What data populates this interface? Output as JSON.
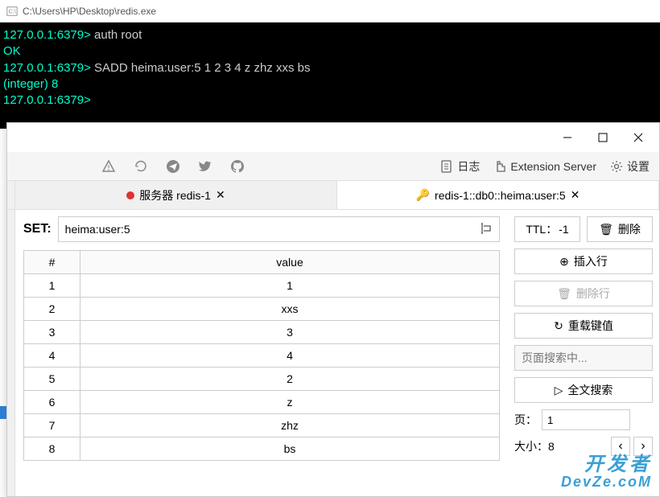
{
  "terminal": {
    "title": "C:\\Users\\HP\\Desktop\\redis.exe",
    "lines": [
      {
        "prompt": "127.0.0.1:6379>",
        "cmd": " auth root"
      },
      {
        "out": "OK"
      },
      {
        "prompt": "127.0.0.1:6379>",
        "cmd": " SADD heima:user:5  1 2 3 4 z zhz xxs bs"
      },
      {
        "out": "(integer) 8"
      },
      {
        "prompt": "127.0.0.1:6379>",
        "cmd": ""
      }
    ]
  },
  "toolbar": {
    "log_label": "日志",
    "ext_label": "Extension Server",
    "settings_label": "设置"
  },
  "tabs": {
    "server": {
      "label": "服务器 redis-1"
    },
    "key": {
      "label": "redis-1::db0::heima:user:5"
    }
  },
  "key_panel": {
    "type_label": "SET:",
    "key_name": "heima:user:5",
    "ttl_label": "TTL：",
    "ttl_value": "-1",
    "delete_label": "删除",
    "columns": {
      "index": "#",
      "value": "value"
    },
    "rows": [
      {
        "i": "1",
        "v": "1"
      },
      {
        "i": "2",
        "v": "xxs"
      },
      {
        "i": "3",
        "v": "3"
      },
      {
        "i": "4",
        "v": "4"
      },
      {
        "i": "5",
        "v": "2"
      },
      {
        "i": "6",
        "v": "z"
      },
      {
        "i": "7",
        "v": "zhz"
      },
      {
        "i": "8",
        "v": "bs"
      }
    ]
  },
  "side": {
    "insert_label": "插入行",
    "delete_row_label": "删除行",
    "reload_label": "重载键值",
    "search_placeholder": "页面搜索中...",
    "fulltext_label": "全文搜索",
    "page_label": "页：",
    "page_value": "1",
    "size_label": "大小：",
    "size_value": "8"
  },
  "watermark": {
    "line1": "开发者",
    "line2": "DevZe.coM"
  }
}
